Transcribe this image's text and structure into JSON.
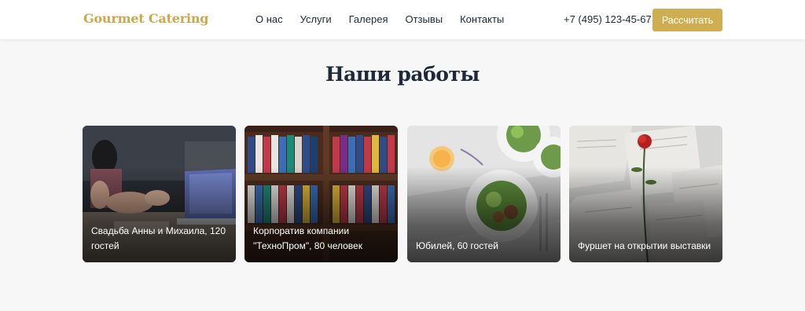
{
  "header": {
    "logo": "Gourmet Catering",
    "nav": [
      "О нас",
      "Услуги",
      "Галерея",
      "Отзывы",
      "Контакты"
    ],
    "phone": "+7 (495) 123-45-67",
    "cta_label": "Рассчитать"
  },
  "gallery": {
    "title": "Наши работы",
    "items": [
      {
        "caption": "Свадьба Анны и Михаила, 120 гостей",
        "image": "office-meeting-photo"
      },
      {
        "caption": "Корпоратив компании \"ТехноПром\", 80 человек",
        "image": "binders-shelf-photo"
      },
      {
        "caption": "Юбилей, 60 гостей",
        "image": "salad-plates-photo"
      },
      {
        "caption": "Фуршет на открытии выставки",
        "image": "rose-on-papers-photo"
      }
    ]
  },
  "colors": {
    "accent": "#cfae52",
    "logo": "#c9a94a",
    "heading": "#1e293b",
    "background": "#f7f7f7"
  }
}
